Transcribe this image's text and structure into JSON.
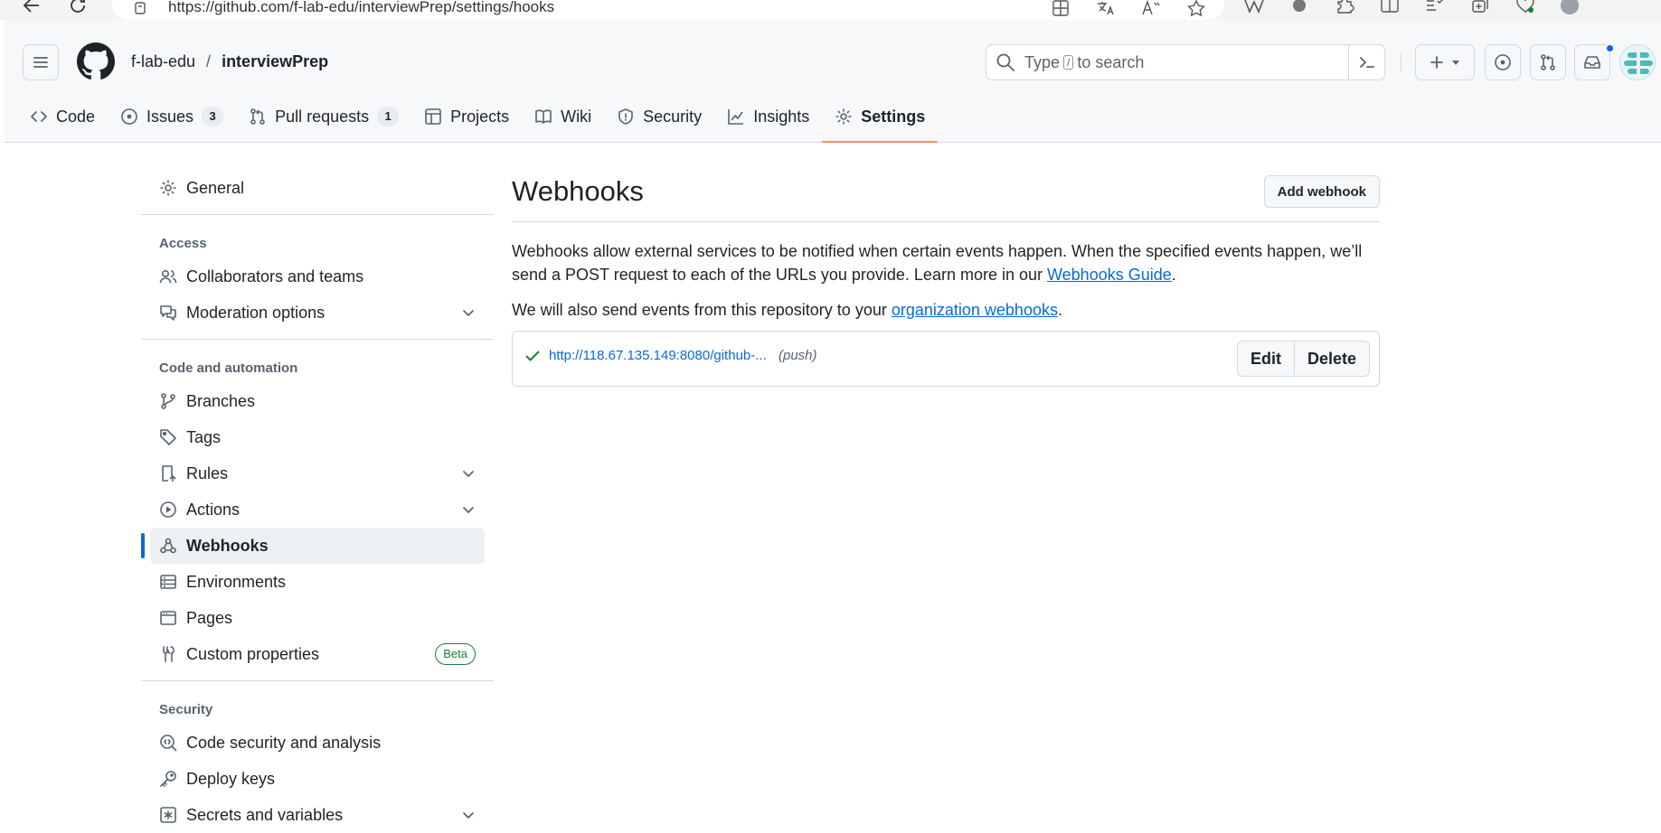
{
  "browser": {
    "url": "https://github.com/f-lab-edu/interviewPrep/settings/hooks"
  },
  "header": {
    "owner": "f-lab-edu",
    "separator": "/",
    "repo": "interviewPrep",
    "search_prefix": "Type",
    "search_key": "/",
    "search_suffix": "to search"
  },
  "tabs": [
    {
      "label": "Code",
      "icon": "code-icon"
    },
    {
      "label": "Issues",
      "icon": "issue-opened-icon",
      "count": "3"
    },
    {
      "label": "Pull requests",
      "icon": "git-pull-request-icon",
      "count": "1"
    },
    {
      "label": "Projects",
      "icon": "table-icon"
    },
    {
      "label": "Wiki",
      "icon": "book-icon"
    },
    {
      "label": "Security",
      "icon": "shield-icon"
    },
    {
      "label": "Insights",
      "icon": "graph-icon"
    },
    {
      "label": "Settings",
      "icon": "gear-icon",
      "selected": true
    }
  ],
  "sidebar": {
    "general": "General",
    "group_access": "Access",
    "collaborators": "Collaborators and teams",
    "moderation": "Moderation options",
    "group_code": "Code and automation",
    "branches": "Branches",
    "tags": "Tags",
    "rules": "Rules",
    "actions": "Actions",
    "webhooks": "Webhooks",
    "environments": "Environments",
    "pages": "Pages",
    "custom_properties": "Custom properties",
    "beta": "Beta",
    "group_security": "Security",
    "code_security": "Code security and analysis",
    "deploy_keys": "Deploy keys",
    "secrets": "Secrets and variables"
  },
  "main": {
    "title": "Webhooks",
    "add_button": "Add webhook",
    "desc_text": "Webhooks allow external services to be notified when certain events happen. When the specified events happen, we’ll send a POST request to each of the URLs you provide. Learn more in our ",
    "desc_link": "Webhooks Guide",
    "desc_end": ".",
    "org_text": "We will also send events from this repository to your ",
    "org_link": "organization webhooks",
    "org_end": ".",
    "hook": {
      "url": "http://118.67.135.149:8080/github-...",
      "events": "(push)",
      "edit": "Edit",
      "delete": "Delete"
    }
  },
  "colors": {
    "accent": "#0969da",
    "selected_tab_underline": "#fd8c73",
    "success": "#1a7f37"
  }
}
